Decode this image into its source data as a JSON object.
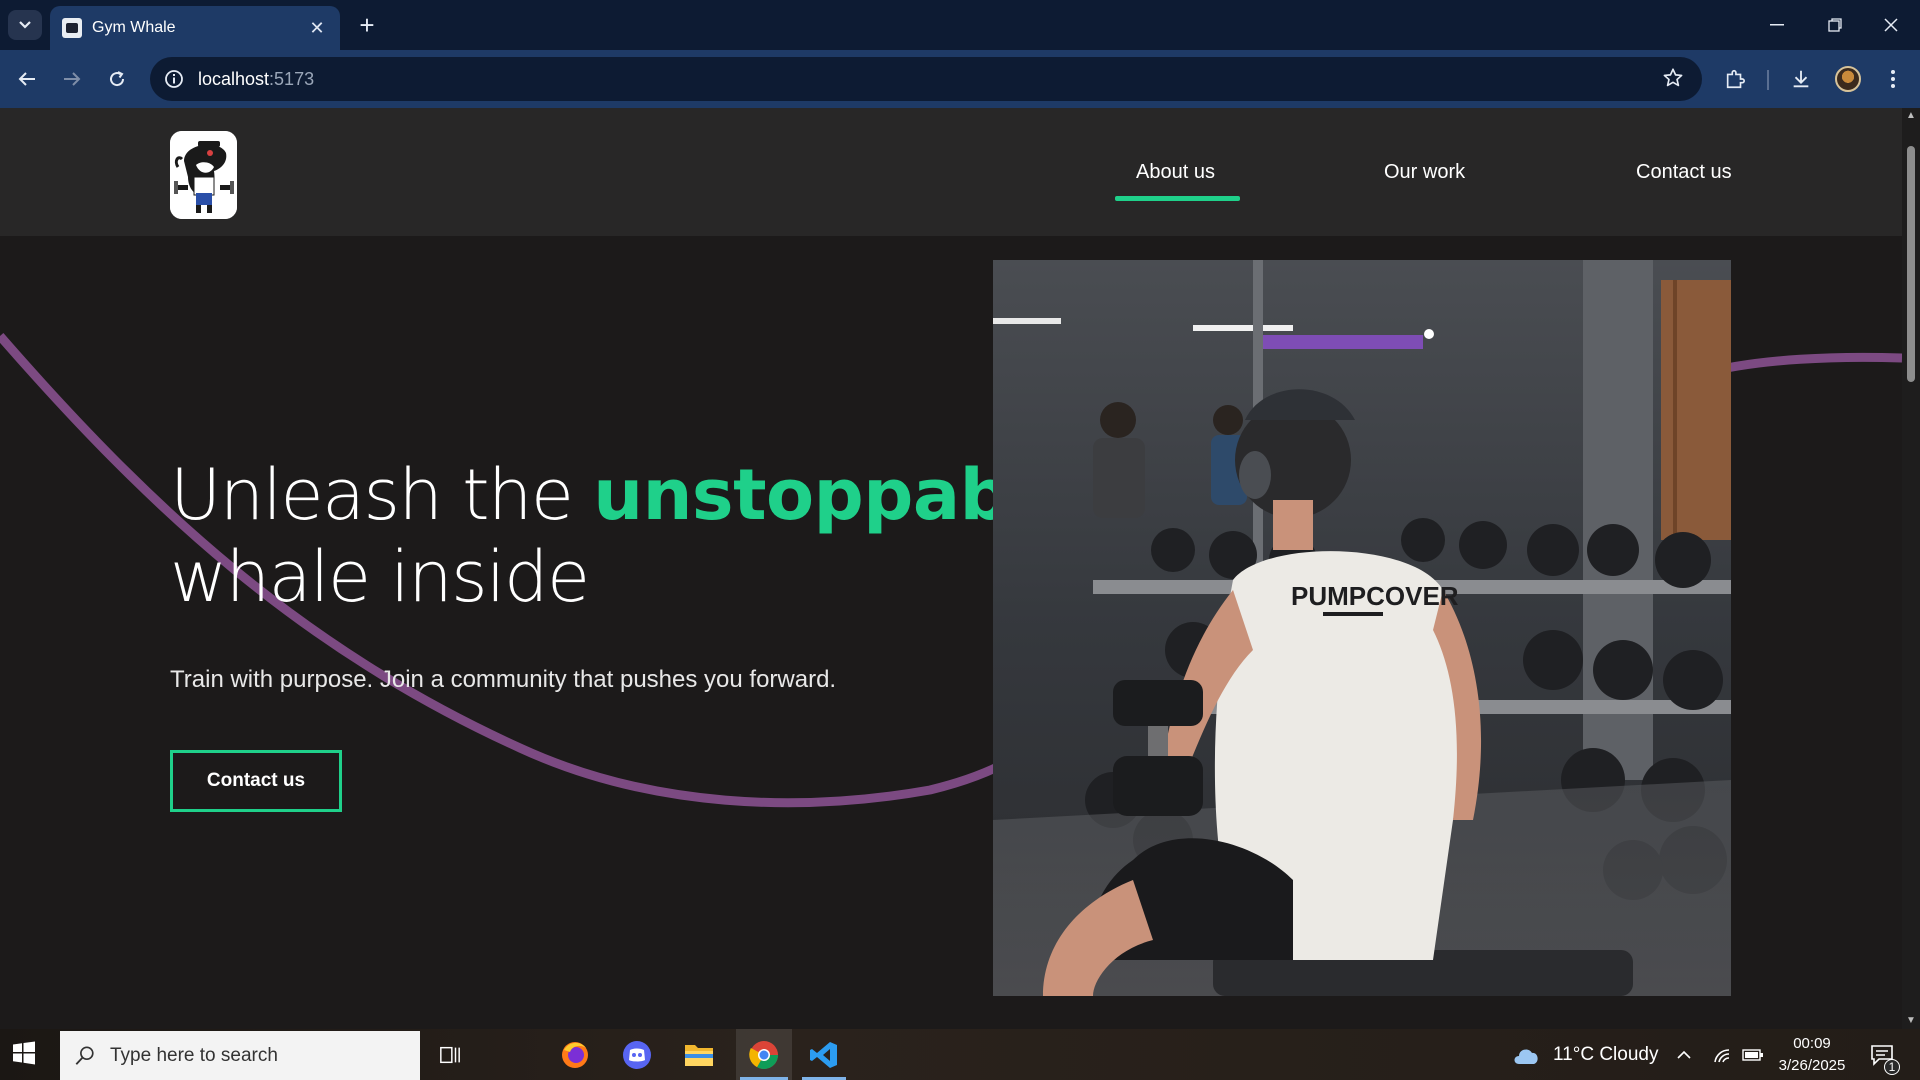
{
  "browser": {
    "tab_title": "Gym Whale",
    "url_host": "localhost",
    "url_port": ":5173"
  },
  "nav": {
    "items": [
      {
        "label": "About us",
        "active": true
      },
      {
        "label": "Our work",
        "active": false
      },
      {
        "label": "Contact us",
        "active": false
      }
    ]
  },
  "hero": {
    "headline_pre": "Unleash the ",
    "headline_accent": "unstoppable",
    "headline_post": "whale inside",
    "subtitle": "Train with purpose. Join a community that pushes you forward.",
    "cta_label": "Contact us",
    "shirt_text": "PUMPCOVER"
  },
  "colors": {
    "accent": "#1fd08a",
    "curve": "#7c4a82",
    "background": "#1c1a1a",
    "header": "#282727"
  },
  "taskbar": {
    "search_placeholder": "Type here to search",
    "weather": "11°C  Cloudy",
    "time": "00:09",
    "date": "3/26/2025",
    "notification_count": "1"
  }
}
